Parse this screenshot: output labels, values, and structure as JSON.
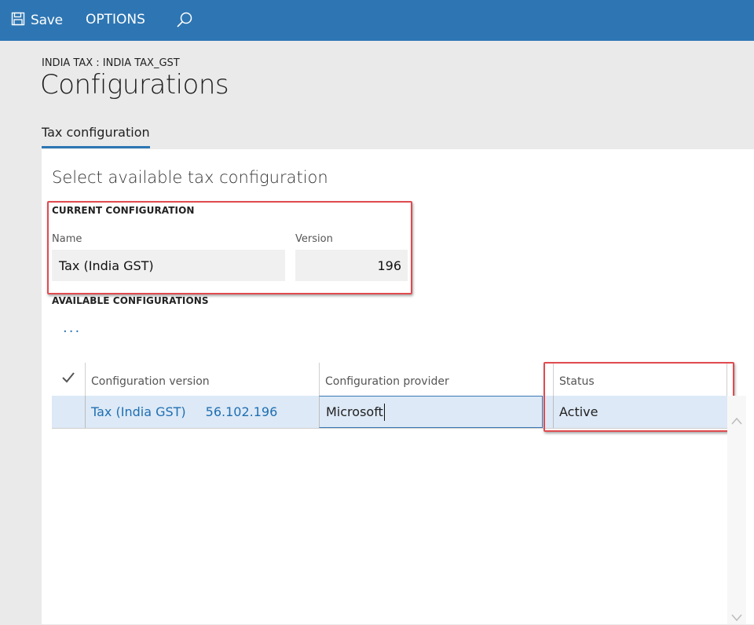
{
  "toolbar": {
    "save_label": "Save",
    "options_label": "OPTIONS",
    "save_icon": "save-icon",
    "search_icon": "search-icon"
  },
  "header": {
    "breadcrumb": "INDIA TAX : INDIA TAX_GST",
    "title": "Configurations"
  },
  "tabs": [
    {
      "label": "Tax configuration",
      "active": true
    }
  ],
  "main": {
    "heading": "Select available tax configuration",
    "current": {
      "group_label": "CURRENT CONFIGURATION",
      "name_label": "Name",
      "name_value": "Tax (India GST)",
      "version_label": "Version",
      "version_value": "196"
    },
    "available": {
      "group_label": "AVAILABLE CONFIGURATIONS",
      "more_label": "···",
      "columns": [
        "Configuration version",
        "Configuration provider",
        "Status"
      ],
      "rows": [
        {
          "version_name": "Tax (India GST)",
          "version_number": "56.102.196",
          "provider": "Microsoft",
          "status": "Active"
        }
      ]
    }
  },
  "colors": {
    "accent": "#2e76b3",
    "highlight": "#e04b4f",
    "selected_row": "#dde9f6"
  }
}
